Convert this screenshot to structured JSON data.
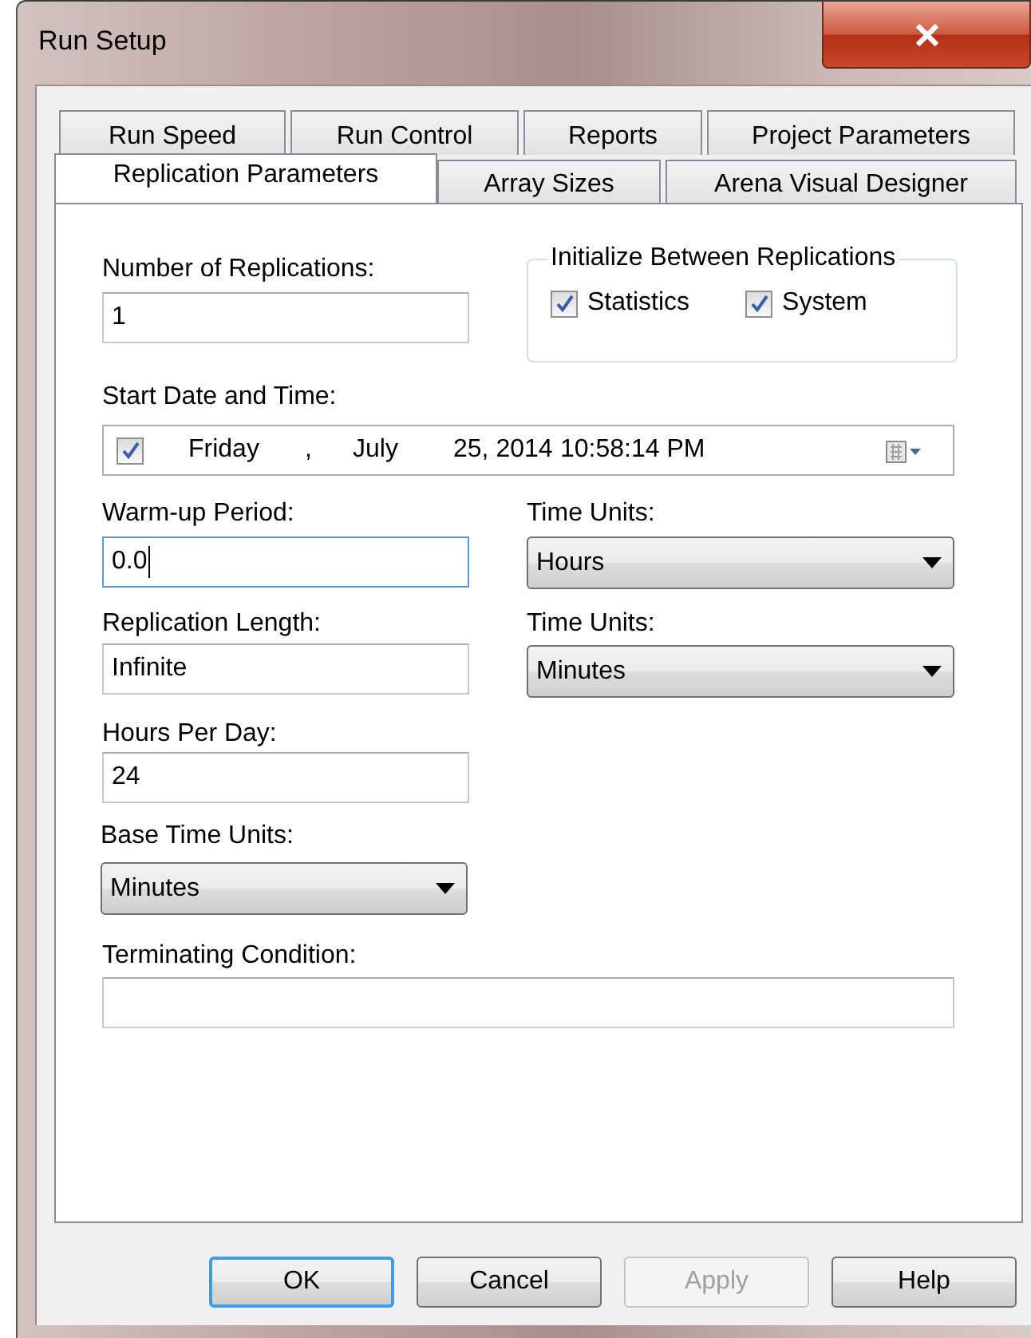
{
  "window": {
    "title": "Run Setup"
  },
  "tab_rows": [
    [
      {
        "label": "Run Speed",
        "selected": false
      },
      {
        "label": "Run Control",
        "selected": false
      },
      {
        "label": "Reports",
        "selected": false
      },
      {
        "label": "Project Parameters",
        "selected": false
      }
    ],
    [
      {
        "label": "Replication Parameters",
        "selected": true
      },
      {
        "label": "Array Sizes",
        "selected": false
      },
      {
        "label": "Arena Visual Designer",
        "selected": false
      }
    ]
  ],
  "number_of_replications": {
    "label": "Number of Replications:",
    "value": "1"
  },
  "initialize_group": {
    "title": "Initialize Between Replications",
    "options": [
      {
        "label": "Statistics",
        "checked": true
      },
      {
        "label": "System",
        "checked": true
      }
    ]
  },
  "start_date_time": {
    "label": "Start Date and Time:",
    "checked": true,
    "segments": [
      "Friday",
      ",",
      "July",
      "25, 2014",
      "10:58:14 PM"
    ]
  },
  "warm_up_period": {
    "label": "Warm-up Period:",
    "value": "0.0",
    "focused": true
  },
  "warm_up_time_units": {
    "label": "Time Units:",
    "value": "Hours"
  },
  "replication_length": {
    "label": "Replication Length:",
    "value": "Infinite"
  },
  "length_time_units": {
    "label": "Time Units:",
    "value": "Minutes"
  },
  "hours_per_day": {
    "label": "Hours Per Day:",
    "value": "24"
  },
  "base_time_units": {
    "label": "Base Time Units:",
    "value": "Minutes"
  },
  "terminating_condition": {
    "label": "Terminating Condition:"
  },
  "buttons": [
    {
      "label": "OK",
      "default": true,
      "disabled": false
    },
    {
      "label": "Cancel",
      "default": false,
      "disabled": false
    },
    {
      "label": "Apply",
      "default": false,
      "disabled": true
    },
    {
      "label": "Help",
      "default": false,
      "disabled": false
    }
  ]
}
